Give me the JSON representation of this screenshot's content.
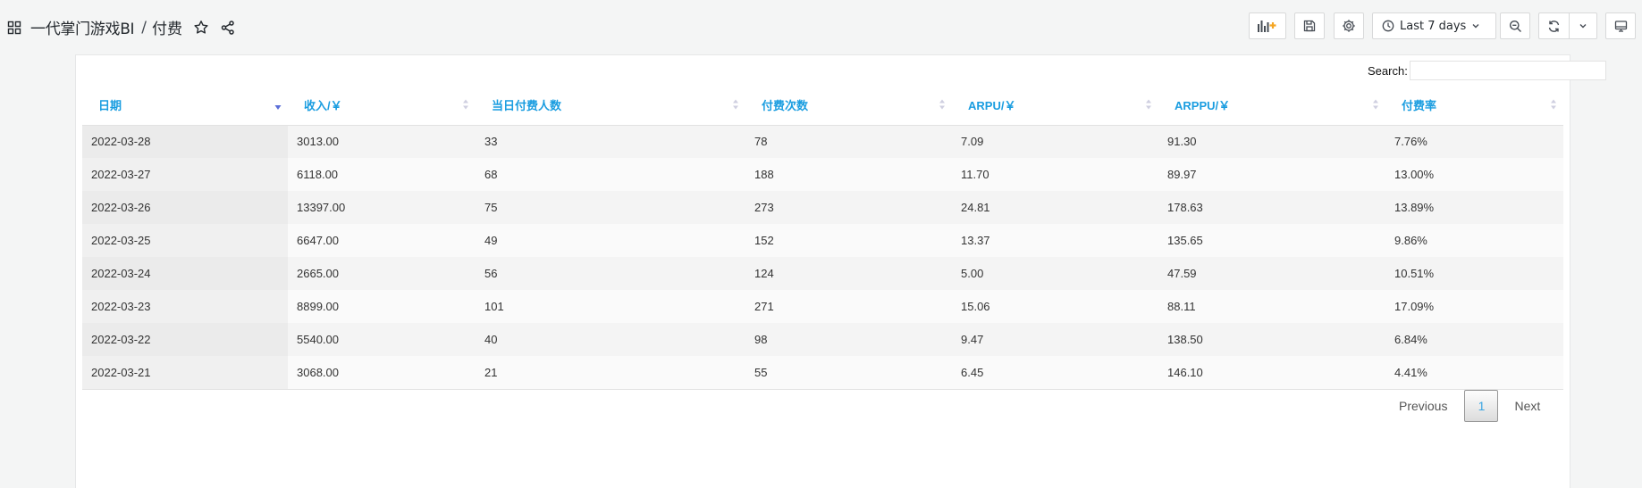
{
  "nav": {
    "folder": "一代掌门游戏BI",
    "separator": "/",
    "title": "付费",
    "time_range": "Last 7 days"
  },
  "search": {
    "label": "Search:",
    "value": ""
  },
  "table": {
    "columns": [
      "日期",
      "收入/￥",
      "当日付费人数",
      "付费次数",
      "ARPU/￥",
      "ARPPU/￥",
      "付费率"
    ],
    "rows": [
      [
        "2022-03-28",
        "3013.00",
        "33",
        "78",
        "7.09",
        "91.30",
        "7.76%"
      ],
      [
        "2022-03-27",
        "6118.00",
        "68",
        "188",
        "11.70",
        "89.97",
        "13.00%"
      ],
      [
        "2022-03-26",
        "13397.00",
        "75",
        "273",
        "24.81",
        "178.63",
        "13.89%"
      ],
      [
        "2022-03-25",
        "6647.00",
        "49",
        "152",
        "13.37",
        "135.65",
        "9.86%"
      ],
      [
        "2022-03-24",
        "2665.00",
        "56",
        "124",
        "5.00",
        "47.59",
        "10.51%"
      ],
      [
        "2022-03-23",
        "8899.00",
        "101",
        "271",
        "15.06",
        "88.11",
        "17.09%"
      ],
      [
        "2022-03-22",
        "5540.00",
        "40",
        "98",
        "9.47",
        "138.50",
        "6.84%"
      ],
      [
        "2022-03-21",
        "3068.00",
        "21",
        "55",
        "6.45",
        "146.10",
        "4.41%"
      ]
    ],
    "sorted_column": "日期",
    "sort_direction": "descending"
  },
  "pagination": {
    "previous": "Previous",
    "current": "1",
    "next": "Next"
  },
  "colors": {
    "header_text": "#1a9de0",
    "page_bg": "#f4f5f5",
    "panel_bg": "#ffffff",
    "add_panel_accent": "#f5a623"
  },
  "icons": [
    "apps-icon",
    "star-icon",
    "share-icon",
    "add-panel-icon",
    "save-icon",
    "gear-icon",
    "clock-icon",
    "chevron-down-icon",
    "zoom-out-icon",
    "refresh-icon",
    "tv-icon",
    "sort-icon"
  ]
}
